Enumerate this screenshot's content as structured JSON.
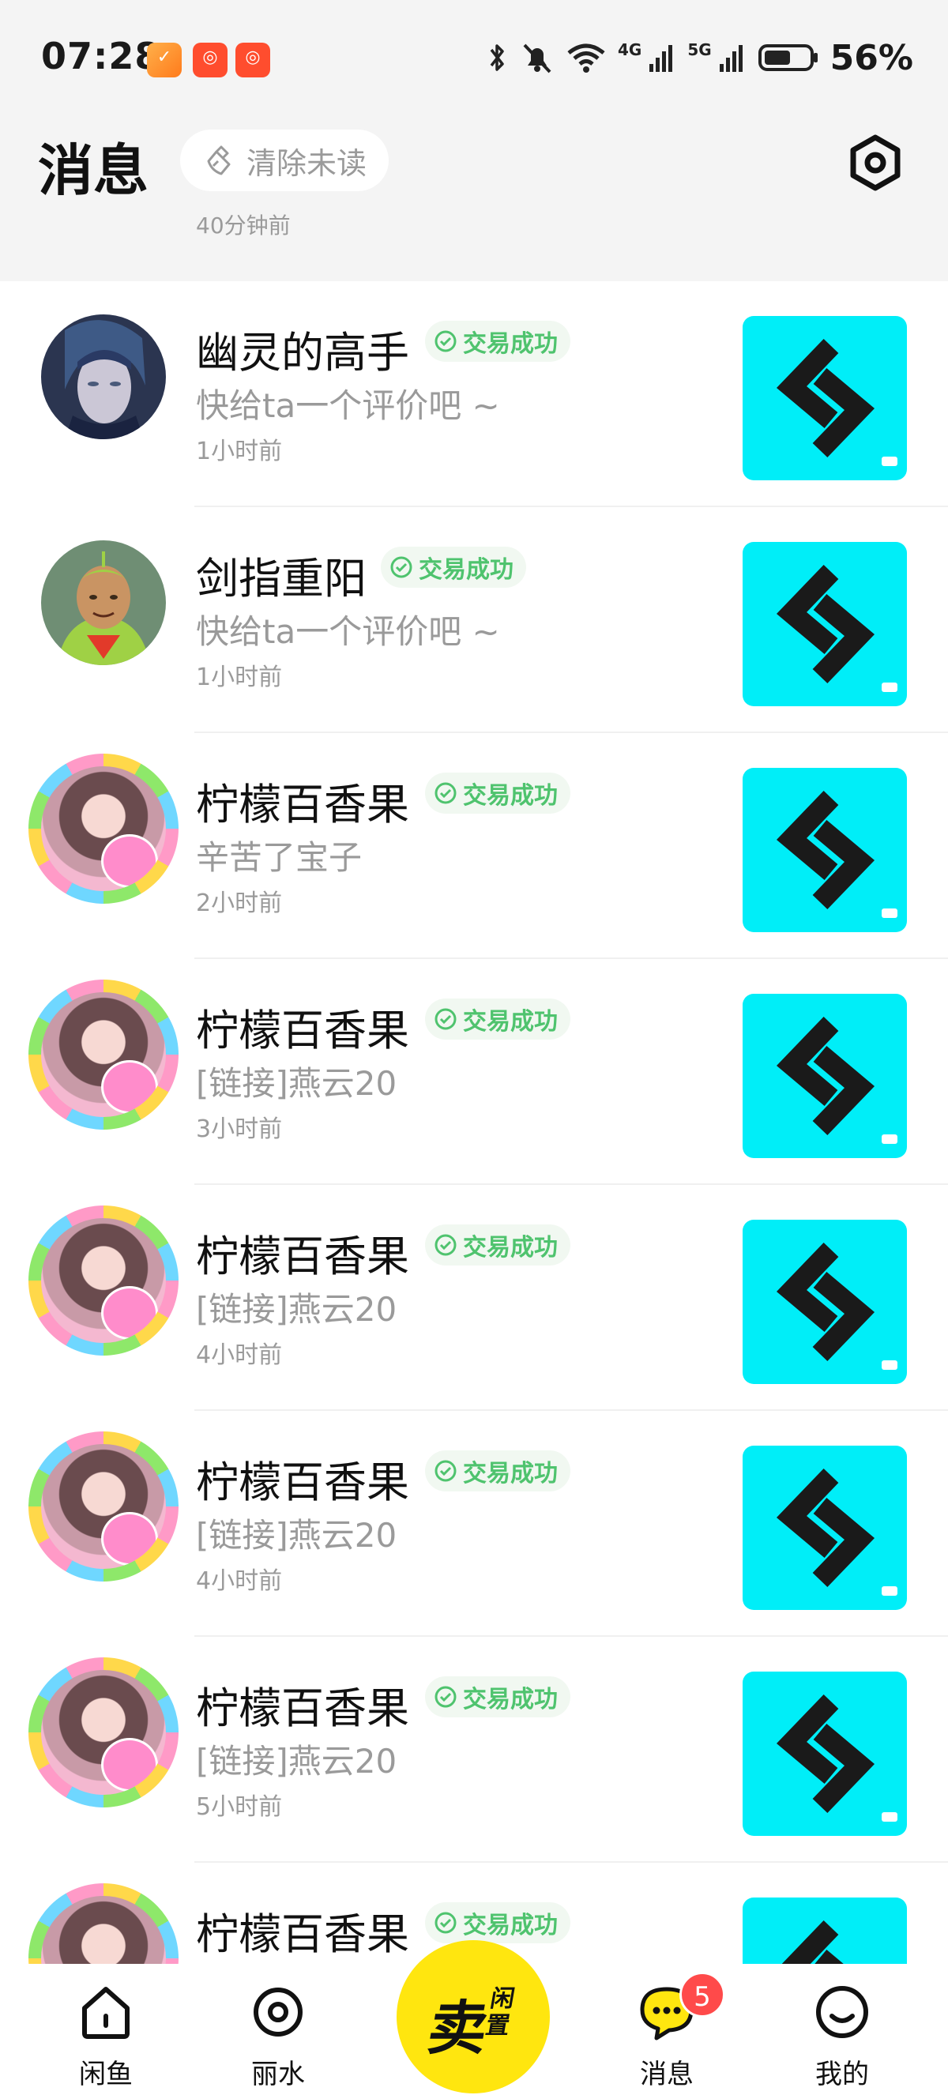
{
  "status_bar": {
    "time": "07:28",
    "network_labels": [
      "4G",
      "5G"
    ],
    "battery": "56%",
    "icons": [
      "bluetooth-icon",
      "mute-bell-icon",
      "wifi-icon",
      "signal-4g-icon",
      "signal-5g-icon",
      "battery-icon"
    ]
  },
  "header": {
    "title": "消息",
    "clear_unread": "清除未读",
    "last_sync": "40分钟前"
  },
  "messages": [
    {
      "name": "幽灵的高手",
      "tag": "交易成功",
      "preview": "快给ta一个评价吧 ~",
      "time": "1小时前"
    },
    {
      "name": "剑指重阳",
      "tag": "交易成功",
      "preview": "快给ta一个评价吧 ~",
      "time": "1小时前"
    },
    {
      "name": "柠檬百香果",
      "tag": "交易成功",
      "preview": "辛苦了宝子",
      "time": "2小时前"
    },
    {
      "name": "柠檬百香果",
      "tag": "交易成功",
      "preview": "[链接]燕云20",
      "time": "3小时前"
    },
    {
      "name": "柠檬百香果",
      "tag": "交易成功",
      "preview": "[链接]燕云20",
      "time": "4小时前"
    },
    {
      "name": "柠檬百香果",
      "tag": "交易成功",
      "preview": "[链接]燕云20",
      "time": "4小时前"
    },
    {
      "name": "柠檬百香果",
      "tag": "交易成功",
      "preview": "[链接]燕云20",
      "time": "5小时前"
    },
    {
      "name": "柠檬百香果",
      "tag": "交易成功",
      "preview": "",
      "time": ""
    }
  ],
  "tab_bar": {
    "tabs": [
      {
        "label": "闲鱼"
      },
      {
        "label": "丽水"
      },
      {
        "label": "消息"
      },
      {
        "label": "我的"
      }
    ],
    "sell_big": "卖",
    "sell_small": "闲置",
    "message_badge": "5"
  },
  "colors": {
    "accent_yellow": "#ffe60f",
    "success_green": "#4fc36e",
    "thumb_cyan": "#00eef8",
    "badge_red": "#ff4a4a"
  }
}
